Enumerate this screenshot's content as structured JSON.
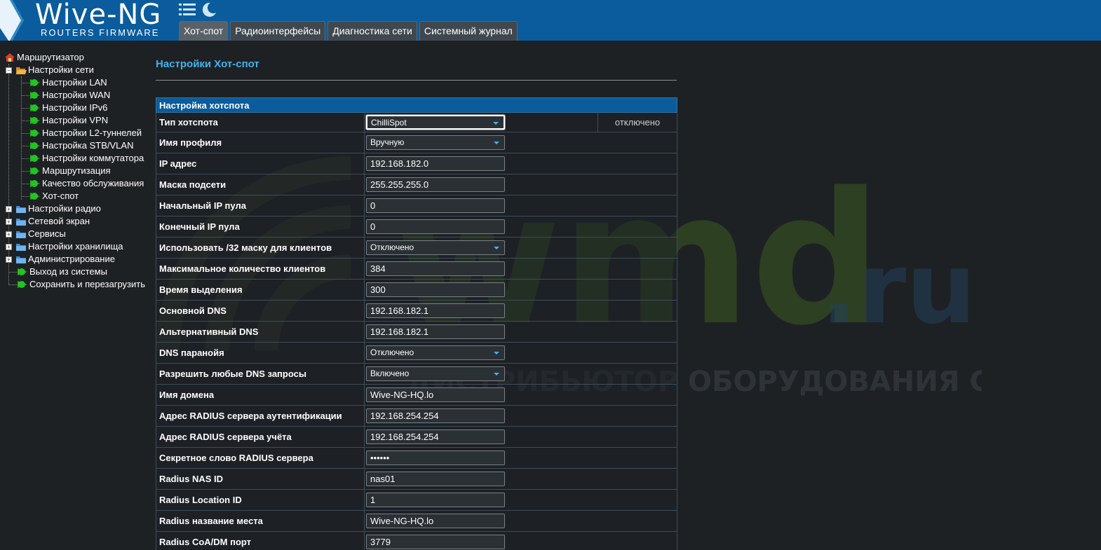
{
  "header": {
    "logo_title": "Wive-NG",
    "logo_subtitle": "ROUTERS FIRMWARE",
    "tabs": [
      {
        "label": "Хот-спот"
      },
      {
        "label": "Радиоинтерфейсы"
      },
      {
        "label": "Диагностика сети"
      },
      {
        "label": "Системный журнал"
      }
    ]
  },
  "sidebar": {
    "root": "Маршрутизатор",
    "items": [
      {
        "label": "Настройки сети"
      },
      {
        "label": "Настройки LAN"
      },
      {
        "label": "Настройки WAN"
      },
      {
        "label": "Настройки IPv6"
      },
      {
        "label": "Настройки VPN"
      },
      {
        "label": "Настройки L2-туннелей"
      },
      {
        "label": "Настройка STB/VLAN"
      },
      {
        "label": "Настройки коммутатора"
      },
      {
        "label": "Маршрутизация"
      },
      {
        "label": "Качество обслуживания"
      },
      {
        "label": "Хот-спот"
      },
      {
        "label": "Настройки радио"
      },
      {
        "label": "Сетевой экран"
      },
      {
        "label": "Сервисы"
      },
      {
        "label": "Настройки хранилища"
      },
      {
        "label": "Администрирование"
      },
      {
        "label": "Выход из системы"
      },
      {
        "label": "Сохранить и перезагрузить"
      }
    ]
  },
  "main": {
    "title": "Настройки Хот-спот",
    "section_caption": "Настройка хотспота",
    "status": "отключено",
    "rows": [
      {
        "label": "Тип хотспота",
        "value": "ChilliSpot"
      },
      {
        "label": "Имя профиля",
        "value": "Вручную"
      },
      {
        "label": "IP адрес",
        "value": "192.168.182.0"
      },
      {
        "label": "Маска подсети",
        "value": "255.255.255.0"
      },
      {
        "label": "Начальный IP пула",
        "value": "0"
      },
      {
        "label": "Конечный IP пула",
        "value": "0"
      },
      {
        "label": "Использовать /32 маску для клиентов",
        "value": "Отключено"
      },
      {
        "label": "Максимальное количество клиентов",
        "value": "384"
      },
      {
        "label": "Время выделения",
        "value": "300"
      },
      {
        "label": "Основной DNS",
        "value": "192.168.182.1"
      },
      {
        "label": "Альтернативный DNS",
        "value": "192.168.182.1"
      },
      {
        "label": "DNS паранойя",
        "value": "Отключено"
      },
      {
        "label": "Разрешить любые DNS запросы",
        "value": "Включено"
      },
      {
        "label": "Имя домена",
        "value": "Wive-NG-HQ.lo"
      },
      {
        "label": "Адрес RADIUS сервера аутентификации",
        "value": "192.168.254.254"
      },
      {
        "label": "Адрес RADIUS сервера учёта",
        "value": "192.168.254.254"
      },
      {
        "label": "Секретное слово RADIUS сервера",
        "value": "••••••"
      },
      {
        "label": "Radius NAS ID",
        "value": "nas01"
      },
      {
        "label": "Radius Location ID",
        "value": "1"
      },
      {
        "label": "Radius название места",
        "value": "Wive-NG-HQ.lo"
      },
      {
        "label": "Radius CoA/DM порт",
        "value": "3779"
      }
    ]
  },
  "watermark": {
    "brand": "wmd",
    "tld": ".ru",
    "tagline": "ДИСТРИБЬЮТОР ОБОРУДОВАНИЯ СВЯЗИ"
  },
  "colors": {
    "header_bg": "#0a5c9c",
    "page_bg": "#1e2124",
    "title_accent": "#3fb3f0",
    "leaf_icon": "#1db31d"
  }
}
